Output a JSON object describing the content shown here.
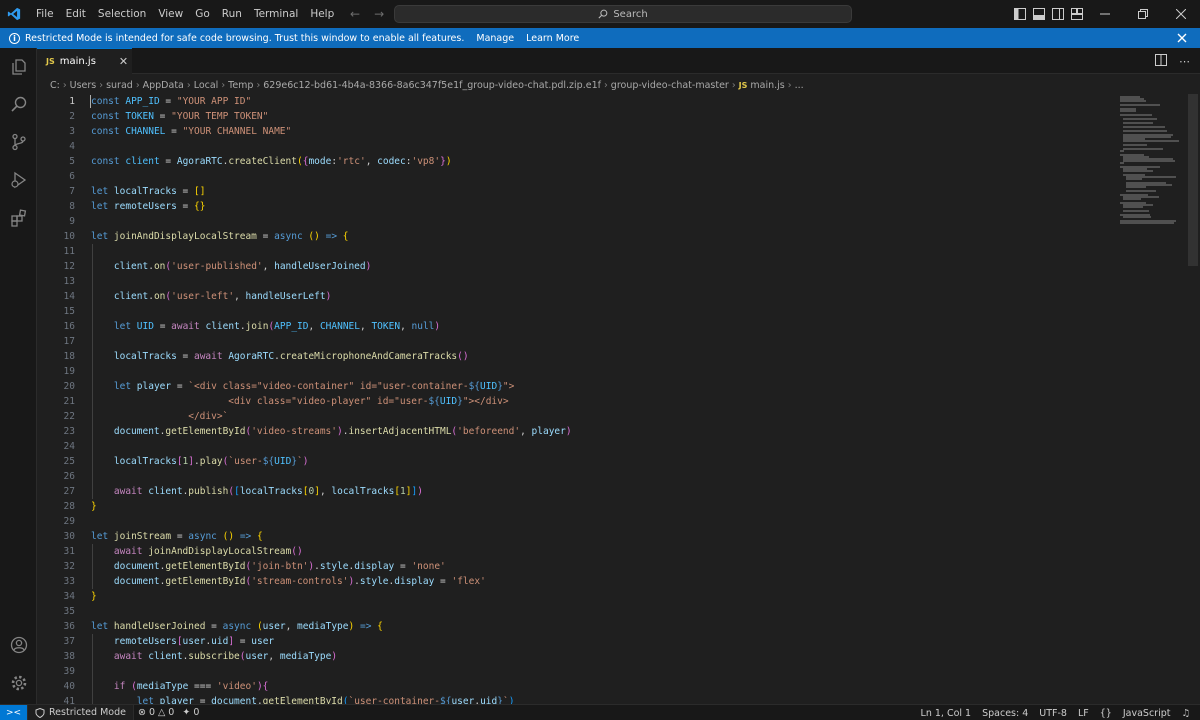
{
  "menu": [
    "File",
    "Edit",
    "Selection",
    "View",
    "Go",
    "Run",
    "Terminal",
    "Help"
  ],
  "search": {
    "label": "Search"
  },
  "banner": {
    "message": "Restricted Mode is intended for safe code browsing. Trust this window to enable all features.",
    "manage": "Manage",
    "learn_more": "Learn More"
  },
  "tab": {
    "label": "main.js",
    "badge": "JS"
  },
  "breadcrumb": {
    "root": "C:",
    "parts": [
      "Users",
      "surad",
      "AppData",
      "Local",
      "Temp",
      "629e6c12-bd61-4b4a-8366-8a6c347f5e1f_group-video-chat.pdl.zip.e1f",
      "group-video-chat-master"
    ],
    "file": "main.js",
    "tail": "..."
  },
  "editor": {
    "line_numbers": [
      "1",
      "2",
      "3",
      "4",
      "5",
      "6",
      "7",
      "8",
      "9",
      "10",
      "11",
      "12",
      "13",
      "14",
      "15",
      "16",
      "17",
      "18",
      "19",
      "20",
      "21",
      "22",
      "23",
      "24",
      "25",
      "26",
      "27",
      "28",
      "29",
      "30",
      "31",
      "32",
      "33",
      "34",
      "35",
      "36",
      "37",
      "38",
      "39",
      "40",
      "41"
    ],
    "active_line": "1"
  },
  "status": {
    "remote_icon": "remote-icon",
    "restricted": "Restricted Mode",
    "errors": "0",
    "warnings": "0",
    "ports": "0",
    "position": "Ln 1, Col 1",
    "spaces": "Spaces: 4",
    "encoding": "UTF-8",
    "eol": "LF",
    "braces": "{}",
    "language": "JavaScript"
  },
  "colors": {
    "accent": "#0078d4",
    "banner": "#0f6cbd",
    "editor_bg": "#1f1f1f"
  }
}
